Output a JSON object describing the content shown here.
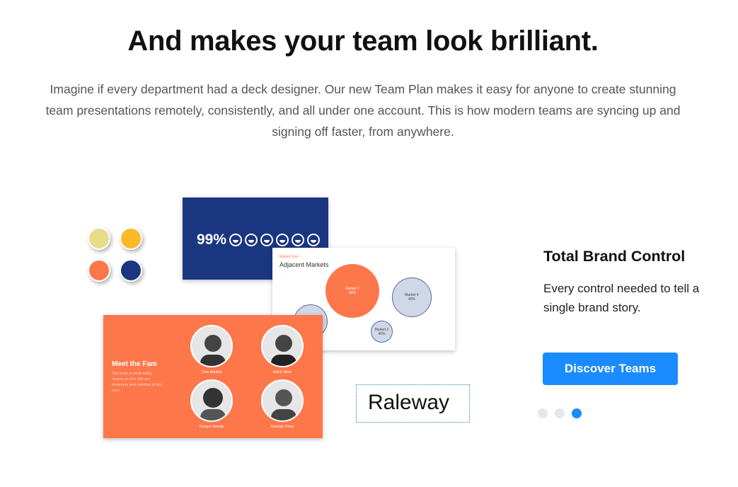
{
  "heading": "And makes your team look brilliant.",
  "intro": "Imagine if every department had a deck designer. Our new Team Plan makes it easy for anyone to create stunning team presentations remotely, consistently, and all under one account. This is how modern teams are syncing up and signing off faster, from anywhere.",
  "swatches": [
    "#e8dc8a",
    "#fbb829",
    "#fe774a",
    "#1b3680"
  ],
  "stat_slide": {
    "value": "99%",
    "icon": "smiley-icon",
    "count": 6
  },
  "market_slide": {
    "label": "Market Size",
    "title": "Adjacent Markets",
    "bubbles": [
      {
        "name": "Market 2",
        "value": "50%"
      },
      {
        "name": "Market 4",
        "value": "40%"
      },
      {
        "name": "Market 3",
        "value": "40%"
      }
    ]
  },
  "team_slide": {
    "title": "Meet the Fam",
    "text": "Our team is what really makes us tick. We are dreamers and creators to the core.",
    "members": [
      "Tina Bouldo",
      "Hank Starr",
      "Fergus Hendy",
      "George Price"
    ]
  },
  "font_sample": "Raleway",
  "feature": {
    "title": "Total Brand Control",
    "text": "Every control needed to tell a single brand story.",
    "button": "Discover Teams"
  },
  "carousel": {
    "count": 3,
    "active": 3
  },
  "colors": {
    "accent": "#1a8cff",
    "orange": "#fe774a",
    "navy": "#1b3680",
    "dot_inactive": "#e1e8ee"
  }
}
